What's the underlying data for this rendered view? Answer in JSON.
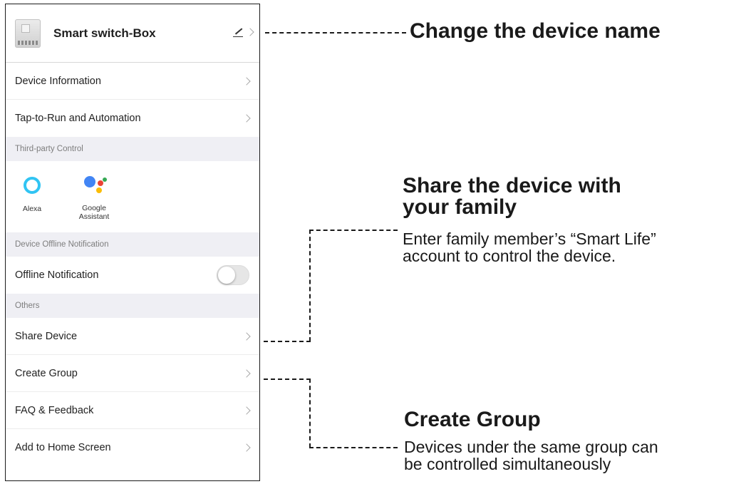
{
  "phone": {
    "header": {
      "device_name": "Smart switch-Box"
    },
    "rows_top": [
      {
        "label": "Device Information"
      },
      {
        "label": "Tap-to-Run and Automation"
      }
    ],
    "sections": {
      "third_party": "Third-party Control",
      "offline": "Device Offline Notification",
      "others": "Others"
    },
    "third_party": [
      {
        "label": "Alexa",
        "icon": "alexa-icon",
        "color": "#31c4f3"
      },
      {
        "label_line1": "Google",
        "label_line2": "Assistant",
        "icon": "google-assistant-icon"
      }
    ],
    "offline_row": {
      "label": "Offline Notification",
      "toggle_on": false
    },
    "others_rows": [
      {
        "label": "Share Device"
      },
      {
        "label": "Create Group"
      },
      {
        "label": "FAQ & Feedback"
      },
      {
        "label": "Add to Home Screen"
      }
    ]
  },
  "callouts": {
    "rename": {
      "title": "Change the device name"
    },
    "share": {
      "title_line1": "Share the device with",
      "title_line2": "your family",
      "body_line1": "Enter family member’s “Smart Life”",
      "body_line2": "account to control the device."
    },
    "group": {
      "title": "Create Group",
      "body_line1": "Devices under the same group can",
      "body_line2": "be controlled simultaneously"
    }
  }
}
